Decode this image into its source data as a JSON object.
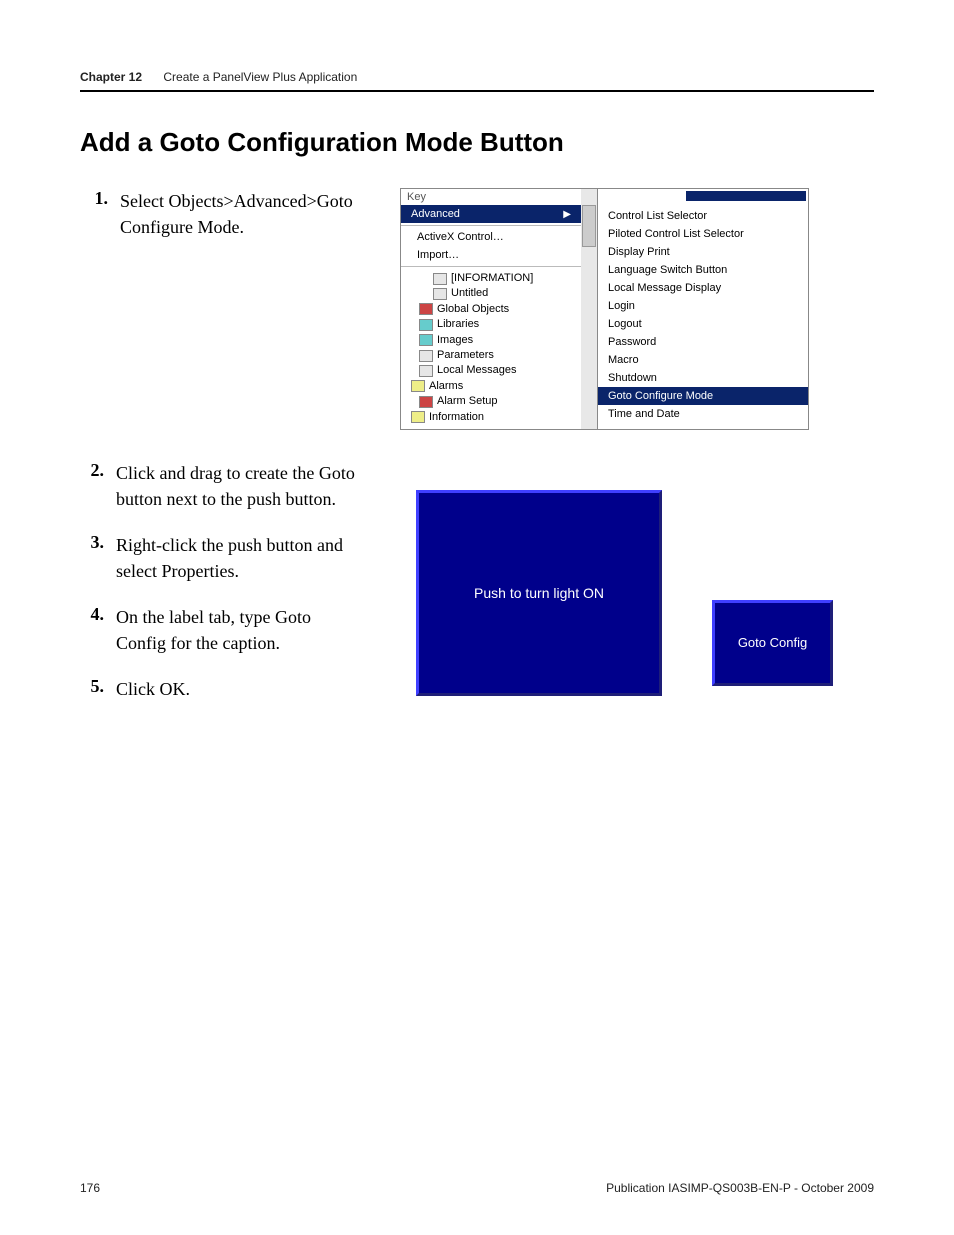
{
  "header": {
    "chapter": "Chapter  12",
    "title": "Create a PanelView Plus Application"
  },
  "section_title": "Add a Goto Configuration Mode Button",
  "steps": [
    {
      "num": "1.",
      "text": "Select Objects>Advanced>Goto Configure Mode."
    },
    {
      "num": "2.",
      "text": "Click and drag to create the Goto button next to the push button."
    },
    {
      "num": "3.",
      "text": "Right-click the push button and select Properties."
    },
    {
      "num": "4.",
      "text": "On the label tab, type Goto Config for the caption."
    },
    {
      "num": "5.",
      "text": "Click OK."
    }
  ],
  "figure1": {
    "left_top": "Key",
    "menu_highlight": "Advanced",
    "menu_items": [
      "ActiveX Control…",
      "Import…"
    ],
    "tree": [
      {
        "label": "[INFORMATION]",
        "indent": 22,
        "icon": ""
      },
      {
        "label": "Untitled",
        "indent": 22,
        "icon": ""
      },
      {
        "label": "Global Objects",
        "indent": 8,
        "icon": "red"
      },
      {
        "label": "Libraries",
        "indent": 8,
        "icon": "cyan"
      },
      {
        "label": "Images",
        "indent": 8,
        "icon": "cyan"
      },
      {
        "label": "Parameters",
        "indent": 8,
        "icon": ""
      },
      {
        "label": "Local Messages",
        "indent": 8,
        "icon": ""
      },
      {
        "label": "Alarms",
        "indent": 0,
        "icon": "yellow"
      },
      {
        "label": "Alarm Setup",
        "indent": 8,
        "icon": "red"
      },
      {
        "label": "Information",
        "indent": 0,
        "icon": "yellow"
      }
    ],
    "submenu": [
      {
        "label": "Control List Selector"
      },
      {
        "label": "Piloted Control List Selector"
      },
      {
        "label": "Display Print"
      },
      {
        "label": "Language Switch Button"
      },
      {
        "label": "Local Message Display"
      },
      {
        "label": "Login"
      },
      {
        "label": "Logout"
      },
      {
        "label": "Password"
      },
      {
        "label": "Macro"
      },
      {
        "label": "Shutdown"
      },
      {
        "label": "Goto Configure Mode",
        "highlight": true
      },
      {
        "label": "Time and Date"
      }
    ]
  },
  "figure2": {
    "push_label": "Push to turn light ON",
    "goto_label": "Goto Config"
  },
  "footer": {
    "page": "176",
    "pub": "Publication IASIMP-QS003B-EN-P - October 2009"
  }
}
